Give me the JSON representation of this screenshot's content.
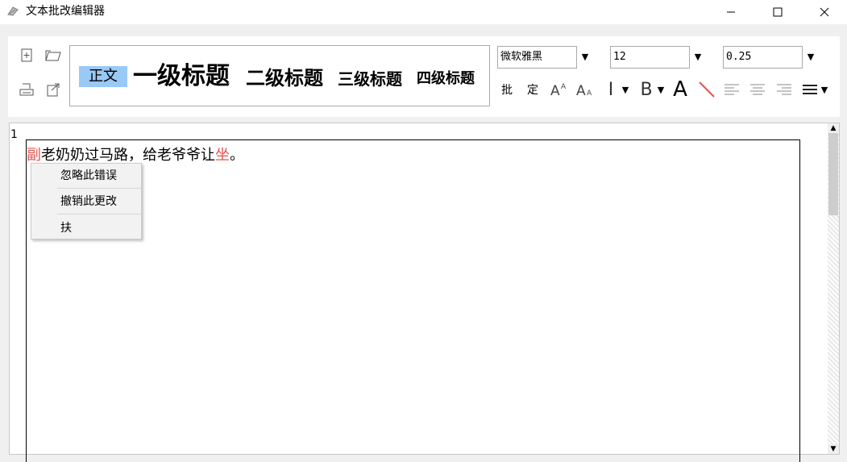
{
  "window": {
    "title": "文本批改编辑器"
  },
  "ribbon": {
    "styles": {
      "body": "正文",
      "h1": "一级标题",
      "h2": "二级标题",
      "h3": "三级标题",
      "h4": "四级标题"
    },
    "font_family": "微软雅黑",
    "font_size": "12",
    "line_spacing": "0.25",
    "format_buttons": {
      "comment": "批",
      "confirm": "定",
      "font_color": "A",
      "bold": "B",
      "italic": "I"
    }
  },
  "editor": {
    "page_number": "1",
    "text_before_error1": "",
    "error1": "副",
    "text_middle": "老奶奶过马路，给老爷爷让",
    "error2": "坐",
    "text_after": "。"
  },
  "context_menu": {
    "items": [
      "忽略此错误",
      "撤销此更改",
      "扶"
    ]
  },
  "colors": {
    "error_red": "#e8534f",
    "style_highlight": "#99c9f5"
  }
}
